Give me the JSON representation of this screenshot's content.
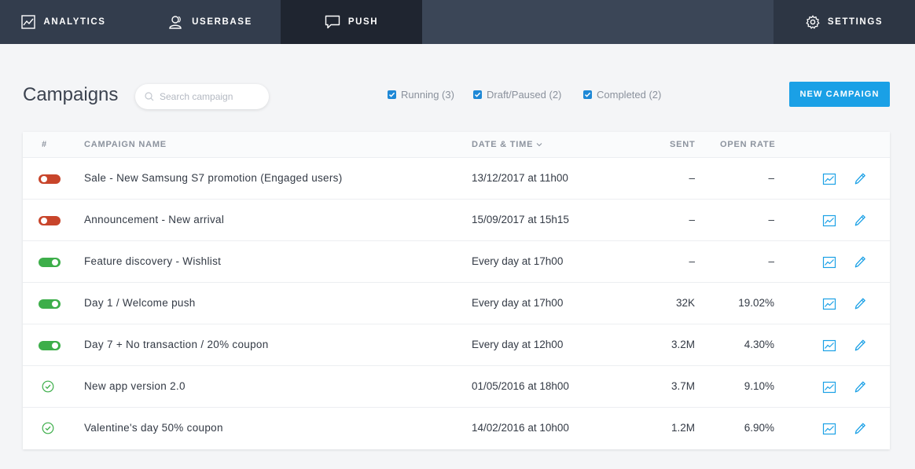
{
  "nav": {
    "analytics": "ANALYTICS",
    "userbase": "USERBASE",
    "push": "PUSH",
    "settings": "SETTINGS"
  },
  "page": {
    "title": "Campaigns"
  },
  "search": {
    "placeholder": "Search campaign",
    "value": ""
  },
  "filters": {
    "running": "Running (3)",
    "draft": "Draft/Paused (2)",
    "completed": "Completed (2)"
  },
  "new_campaign_label": "NEW CAMPAIGN",
  "table": {
    "headers": {
      "index": "#",
      "name": "CAMPAIGN NAME",
      "date": "DATE & TIME",
      "sent": "SENT",
      "open_rate": "OPEN RATE"
    },
    "rows": [
      {
        "status": "off",
        "name": "Sale - New Samsung S7 promotion (Engaged users)",
        "date": "13/12/2017 at 11h00",
        "sent": "–",
        "open_rate": "–"
      },
      {
        "status": "off",
        "name": "Announcement - New arrival",
        "date": "15/09/2017 at 15h15",
        "sent": "–",
        "open_rate": "–"
      },
      {
        "status": "on",
        "name": "Feature discovery - Wishlist",
        "date": "Every day at 17h00",
        "sent": "–",
        "open_rate": "–"
      },
      {
        "status": "on",
        "name": "Day 1 / Welcome push",
        "date": "Every day at 17h00",
        "sent": "32K",
        "open_rate": "19.02%"
      },
      {
        "status": "on",
        "name": "Day 7 + No transaction / 20% coupon",
        "date": "Every day at 12h00",
        "sent": "3.2M",
        "open_rate": "4.30%"
      },
      {
        "status": "completed",
        "name": "New app version 2.0",
        "date": "01/05/2016 at 18h00",
        "sent": "3.7M",
        "open_rate": "9.10%"
      },
      {
        "status": "completed",
        "name": "Valentine's day 50% coupon",
        "date": "14/02/2016 at 10h00",
        "sent": "1.2M",
        "open_rate": "6.90%"
      }
    ]
  },
  "colors": {
    "accent": "#1aa0e6",
    "toggle_off": "#c8452b",
    "toggle_on": "#3dae4a",
    "completed": "#3dae4a",
    "nav_bg": "#323c4c",
    "nav_active": "#1f2530"
  },
  "icons": {
    "analytics": "chart-icon",
    "userbase": "users-icon",
    "push": "speech-bubble-icon",
    "settings": "gear-icon",
    "search": "search-icon",
    "row_stats": "stats-chart-icon",
    "row_edit": "pencil-icon",
    "completed": "check-circle-icon",
    "sort": "chevron-down-icon"
  }
}
